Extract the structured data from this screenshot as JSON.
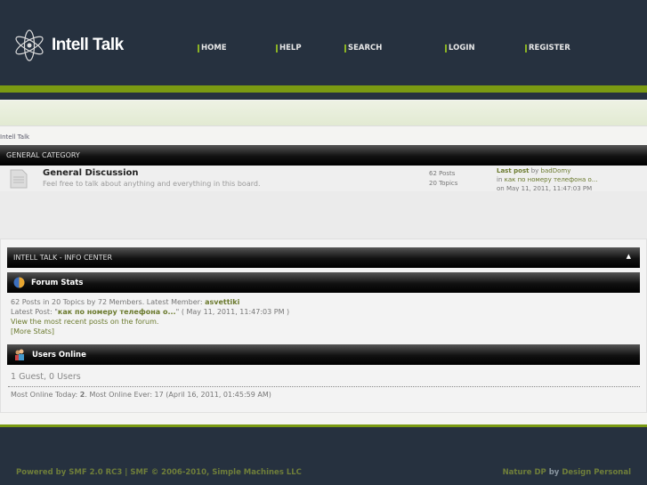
{
  "header": {
    "site_title": "Intell Talk",
    "nav": [
      "HOME",
      "HELP",
      "SEARCH",
      "LOGIN",
      "REGISTER"
    ]
  },
  "breadcrumb": "Intell Talk",
  "category": {
    "title": "GENERAL CATEGORY",
    "board": {
      "name": "General Discussion",
      "description": "Feel free to talk about anything and everything in this board.",
      "posts": "62 Posts",
      "topics": "20 Topics",
      "last_post_label": "Last post",
      "by": "by",
      "author": "badDomy",
      "in": "in",
      "topic": "как по номеру телефона о...",
      "date": "on May 11, 2011, 11:47:03 PM"
    }
  },
  "info_center": {
    "title": "INTELL TALK - INFO CENTER",
    "forum_stats": {
      "title": "Forum Stats",
      "line1": "62 Posts in 20 Topics by 72 Members. Latest Member:",
      "latest_member": "asvettiki",
      "latest_post_label": "Latest Post: \"",
      "latest_post": "как по номеру телефона о...",
      "latest_post_date": "\" ( May 11, 2011, 11:47:03 PM )",
      "recent_link": "View the most recent posts on the forum.",
      "more_stats": "[More Stats]"
    },
    "users_online": {
      "title": "Users Online",
      "summary": "1 Guest, 0 Users",
      "most_today_label": "Most Online Today:",
      "most_today": "2",
      "most_ever": ". Most Online Ever: 17 (April 16, 2011, 01:45:59 AM)"
    }
  },
  "footer": {
    "left": "Powered by SMF 2.0 RC3 | SMF © 2006-2010, Simple Machines LLC",
    "right_theme": "Nature DP",
    "right_by": "by",
    "right_author": "Design Personal"
  }
}
